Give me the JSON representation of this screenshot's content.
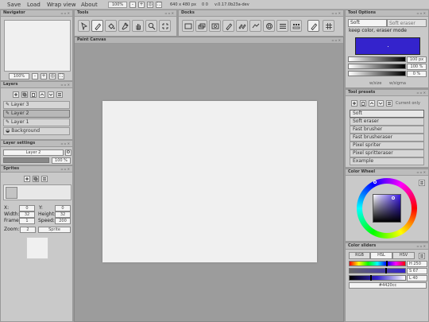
{
  "menubar": {
    "items": [
      "Save",
      "Load",
      "Wrap view",
      "About"
    ],
    "zoom": "100%",
    "canvas_size": "640 x 480 px",
    "coords": "0 0",
    "version": "v.0.17.0b23a-dev"
  },
  "navigator": {
    "title": "Navigator",
    "zoom": "100%"
  },
  "layers": {
    "title": "Layers",
    "items": [
      "Layer 3",
      "Layer 2",
      "Layer 1",
      "Background"
    ],
    "selected_index": 1
  },
  "layer_settings": {
    "title": "Layer settings",
    "name": "Layer 2",
    "opacity": "100 %"
  },
  "sprites": {
    "title": "Sprites",
    "x_label": "X:",
    "x_value": "0",
    "y_label": "Y:",
    "y_value": "0",
    "width_label": "Width:",
    "width_value": "32",
    "height_label": "Height:",
    "height_value": "32",
    "frames_label": "Frames:",
    "frames_value": "1",
    "speed_label": "Speed:",
    "speed_value": "200",
    "zoom_label": "Zoom:",
    "zoom_value": "2",
    "name_value": "Sprite"
  },
  "tools": {
    "title": "Tools",
    "icons": [
      "select-icon",
      "brush-icon",
      "fill-icon",
      "pipette-icon",
      "hand-icon",
      "zoom-icon",
      "crop-icon"
    ],
    "selected_index": 1
  },
  "docks": {
    "title": "Docks",
    "icons": [
      "canvas-dock-icon",
      "layers-dock-icon",
      "navigator-dock-icon",
      "tool-options-dock-icon",
      "tool-presets-dock-icon",
      "color-sliders-dock-icon",
      "color-wheel-dock-icon",
      "layer-settings-dock-icon",
      "sprites-dock-icon",
      "sketch-dock-icon",
      "grid-dock-icon"
    ],
    "selected_index": 9
  },
  "paint_canvas": {
    "title": "Paint Canvas"
  },
  "tool_options": {
    "title": "Tool Options",
    "preset_name": "Soft",
    "preset_placeholder": "Soft eraser",
    "mode_text": "keep color, eraser mode",
    "size_value": "100 px",
    "opacity_value": "100 %",
    "blend_value": "0 %",
    "footer_left": "w/size",
    "footer_right": "w/sigma",
    "brush_color": "#3423cc"
  },
  "tool_presets": {
    "title": "Tool presets",
    "current_only": "Current only",
    "items": [
      "Soft",
      "Soft eraser",
      "Fast brusher",
      "Fast brusheraser",
      "Pixel spriter",
      "Pixel spritteraser",
      "Example"
    ],
    "selected_index": 0
  },
  "color_wheel": {
    "title": "Color Wheel"
  },
  "color_sliders": {
    "title": "Color sliders",
    "tabs": [
      "RGB",
      "HSL",
      "HSV"
    ],
    "active_tab": 1,
    "h_value": "H 250",
    "s_value": "S 67",
    "l_value": "L 40",
    "hex_value": "#4420cc",
    "hue_level": 0.69,
    "sat_level": 0.67,
    "light_level": 0.4
  }
}
